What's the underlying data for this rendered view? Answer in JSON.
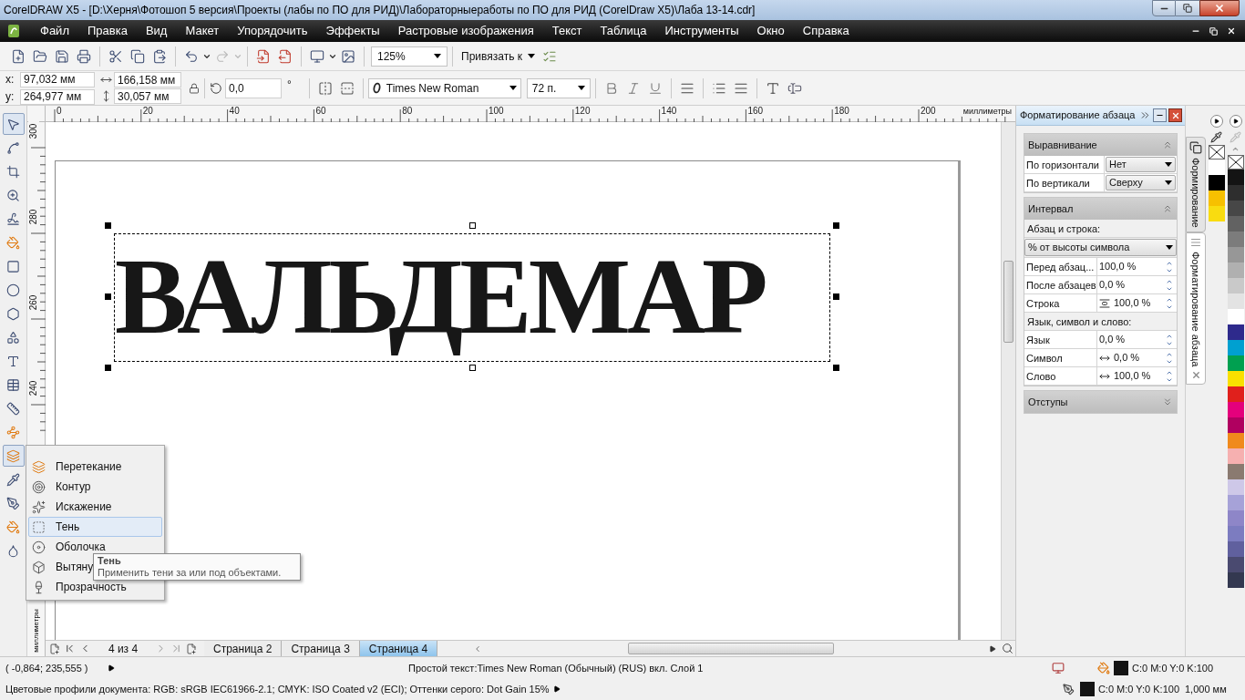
{
  "window": {
    "title": "CorelDRAW X5 - [D:\\Херня\\Фотошоп 5 версия\\Проекты (лабы по ПО для РИД)\\Лабораторныеработы по ПО для РИД (CorelDraw X5)\\Лаба 13-14.cdr]"
  },
  "menu": [
    "Файл",
    "Правка",
    "Вид",
    "Макет",
    "Упорядочить",
    "Эффекты",
    "Растровые изображения",
    "Текст",
    "Таблица",
    "Инструменты",
    "Окно",
    "Справка"
  ],
  "toolbar": {
    "zoom": "125%",
    "snap": "Привязать к"
  },
  "property_bar": {
    "x_label": "x:",
    "x": "97,032 мм",
    "y_label": "y:",
    "y": "264,977 мм",
    "width": "166,158 мм",
    "height": "30,057 мм",
    "angle": "0,0",
    "angle_unit": "°",
    "font": "Times New Roman",
    "font_size": "72 п."
  },
  "tools": [
    {
      "kind": "pick",
      "selected": true
    },
    {
      "kind": "shape",
      "selected": false
    },
    {
      "kind": "crop",
      "selected": false
    },
    {
      "kind": "zoom",
      "selected": false
    },
    {
      "kind": "freehand",
      "selected": false
    },
    {
      "kind": "smartfill",
      "selected": false
    },
    {
      "kind": "rectangle",
      "selected": false
    },
    {
      "kind": "ellipse",
      "selected": false
    },
    {
      "kind": "polygon",
      "selected": false
    },
    {
      "kind": "shapes",
      "selected": false
    },
    {
      "kind": "text",
      "selected": false
    },
    {
      "kind": "table",
      "selected": false
    },
    {
      "kind": "dimension",
      "selected": false
    },
    {
      "kind": "connector",
      "selected": false
    },
    {
      "kind": "blend",
      "selected": true
    },
    {
      "kind": "eyedropper",
      "selected": false
    },
    {
      "kind": "outline",
      "selected": false
    },
    {
      "kind": "fill",
      "selected": false
    },
    {
      "kind": "interactive",
      "selected": false
    }
  ],
  "ruler_x": {
    "labels": [
      "0",
      "20",
      "40",
      "60",
      "80",
      "100",
      "120",
      "140",
      "160",
      "180",
      "200"
    ],
    "unit": "миллиметры"
  },
  "ruler_y": {
    "labels": [
      "300",
      "280",
      "260",
      "240"
    ],
    "unit": "миллиметры"
  },
  "canvas": {
    "text": "ВАЛЬДЕМАР"
  },
  "flyout": {
    "items": [
      {
        "kind": "blend",
        "label": "Перетекание",
        "selected": false
      },
      {
        "kind": "contour",
        "label": "Контур",
        "selected": false
      },
      {
        "kind": "distort",
        "label": "Искажение",
        "selected": false
      },
      {
        "kind": "shadow",
        "label": "Тень",
        "selected": true
      },
      {
        "kind": "envelope",
        "label": "Оболочка",
        "selected": false
      },
      {
        "kind": "extrude",
        "label": "Вытяну",
        "selected": false
      },
      {
        "kind": "transparency",
        "label": "Прозрачность",
        "selected": false
      }
    ]
  },
  "tooltip": {
    "title": "Тень",
    "text": "Применить тени за или под объектами."
  },
  "docker": {
    "title": "Форматирование абзаца",
    "sections": [
      {
        "title": "Выравнивание",
        "expanded": true,
        "rows": [
          {
            "kind": "select",
            "label": "По горизонтали",
            "value": "Нет"
          },
          {
            "kind": "select",
            "label": "По вертикали",
            "value": "Сверху"
          }
        ]
      },
      {
        "title": "Интервал",
        "expanded": true,
        "rows": [
          {
            "kind": "heading",
            "label": "Абзац и строка:"
          },
          {
            "kind": "dropdown",
            "value": "% от высоты символа"
          },
          {
            "kind": "spin",
            "label": "Перед абзац...",
            "value": "100,0 %"
          },
          {
            "kind": "spin",
            "label": "После абзацев",
            "value": "0,0 %"
          },
          {
            "kind": "line-spin",
            "label": "Строка",
            "value": "100,0 %"
          },
          {
            "kind": "heading",
            "label": "Язык, символ и слово:"
          },
          {
            "kind": "spin",
            "label": "Язык",
            "value": "0,0 %"
          },
          {
            "kind": "char-spin",
            "label": "Символ",
            "value": "0,0 %"
          },
          {
            "kind": "word-spin",
            "label": "Слово",
            "value": "100,0 %"
          }
        ]
      },
      {
        "title": "Отступы",
        "expanded": false
      }
    ]
  },
  "docker_tabs": [
    {
      "label": "Формирование",
      "selected": false
    },
    {
      "label": "Форматирование абзаца",
      "selected": true
    }
  ],
  "palettes": [
    {
      "swatches": [
        {
          "kind": "none"
        },
        {
          "kind": "color",
          "color": "#ffffff"
        },
        {
          "kind": "color",
          "color": "#000000"
        },
        {
          "kind": "color",
          "color": "#f7c000"
        },
        {
          "kind": "color",
          "color": "#f9dc10"
        }
      ]
    },
    {
      "swatches": [
        {
          "kind": "none"
        },
        {
          "kind": "color",
          "color": "#141414"
        },
        {
          "kind": "color",
          "color": "#2e2e2e"
        },
        {
          "kind": "color",
          "color": "#474747"
        },
        {
          "kind": "color",
          "color": "#626262"
        },
        {
          "kind": "color",
          "color": "#7c7c7c"
        },
        {
          "kind": "color",
          "color": "#979797"
        },
        {
          "kind": "color",
          "color": "#b0b0b0"
        },
        {
          "kind": "color",
          "color": "#c9c9c9"
        },
        {
          "kind": "color",
          "color": "#e3e3e3"
        },
        {
          "kind": "color",
          "color": "#ffffff"
        },
        {
          "kind": "color",
          "color": "#2e2a8c"
        },
        {
          "kind": "color",
          "color": "#00a0d0"
        },
        {
          "kind": "color",
          "color": "#00a050"
        },
        {
          "kind": "color",
          "color": "#f9e000"
        },
        {
          "kind": "color",
          "color": "#e0201c"
        },
        {
          "kind": "color",
          "color": "#e4007c"
        },
        {
          "kind": "color",
          "color": "#b00060"
        },
        {
          "kind": "color",
          "color": "#f08a1c"
        },
        {
          "kind": "color",
          "color": "#f6b0b0"
        },
        {
          "kind": "color",
          "color": "#8a7a70"
        },
        {
          "kind": "color",
          "color": "#cec8e8"
        },
        {
          "kind": "color",
          "color": "#a6a2d8"
        },
        {
          "kind": "color",
          "color": "#8e86c8"
        },
        {
          "kind": "color",
          "color": "#7c7cc0"
        },
        {
          "kind": "color",
          "color": "#60609e"
        },
        {
          "kind": "color",
          "color": "#4a4a70"
        },
        {
          "kind": "color",
          "color": "#333850"
        }
      ]
    }
  ],
  "page_bar": {
    "counter": "4 из 4",
    "pages": [
      {
        "label": "Страница 2",
        "selected": false
      },
      {
        "label": "Страница 3",
        "selected": false
      },
      {
        "label": "Страница 4",
        "selected": true
      }
    ]
  },
  "status": {
    "coords": "( -0,864; 235,555 )",
    "object_info": "Простой текст:Times New Roman (Обычный) (RUS) вкл. Слой 1",
    "fill": "C:0 M:0 Y:0 K:100",
    "outline": "C:0 M:0 Y:0 K:100",
    "outline_width": "1,000 мм",
    "profiles": "Цветовые профили документа: RGB: sRGB IEC61966-2.1; CMYK: ISO Coated v2 (ECI); Оттенки серого: Dot Gain 15%"
  }
}
